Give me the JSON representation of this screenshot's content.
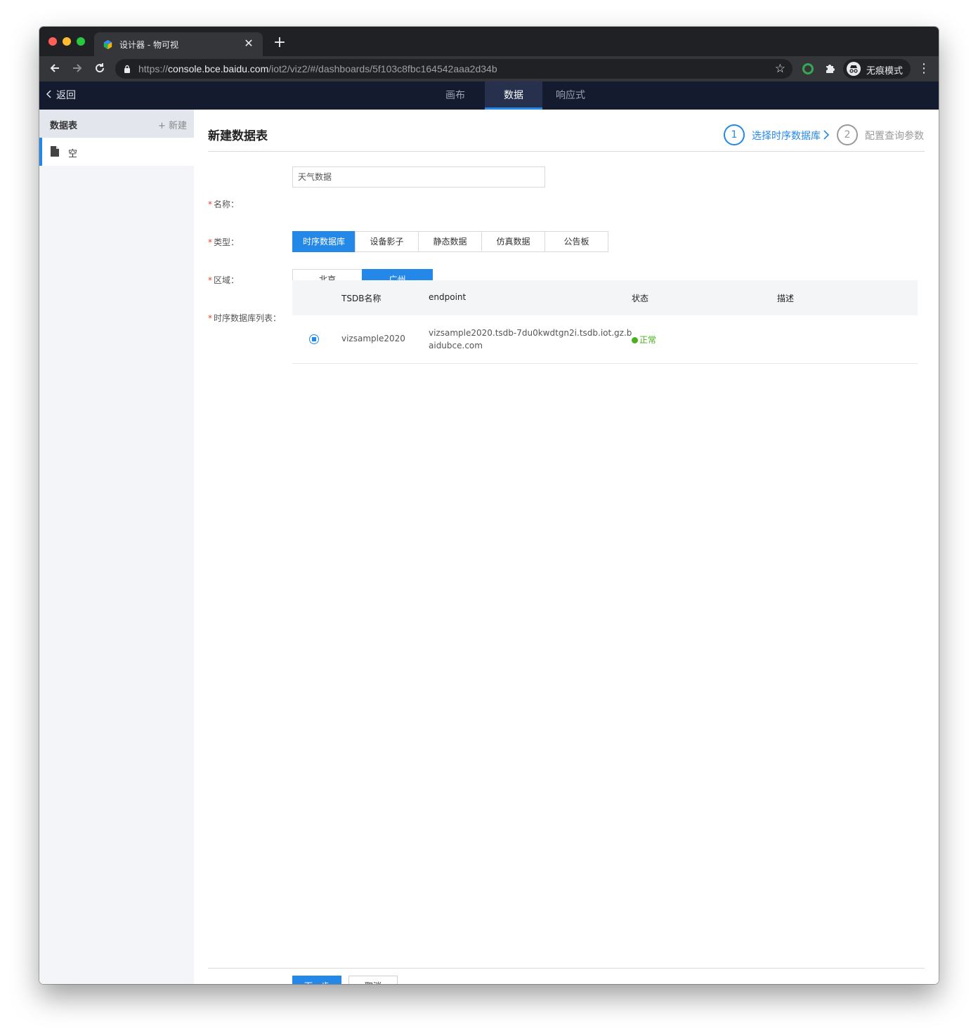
{
  "browser": {
    "tab_title": "设计器 - 物可视",
    "new_tab": "+",
    "close": "✕",
    "url_scheme": "https://",
    "url_host": "console.bce.baidu.com",
    "url_path": "/iot2/viz2/#/dashboards/5f103c8fbc164542aaa2d34b",
    "incognito_label": "无痕模式"
  },
  "appbar": {
    "back_label": "返回",
    "tabs": [
      {
        "label": "画布"
      },
      {
        "label": "数据"
      },
      {
        "label": "响应式"
      }
    ],
    "active_tab": "数据"
  },
  "sidebar": {
    "title": "数据表",
    "new_label": "+ 新建",
    "items": [
      {
        "label": "空"
      }
    ]
  },
  "main": {
    "title": "新建数据表",
    "steps": [
      {
        "number": "1",
        "label": "选择时序数据库",
        "active": true
      },
      {
        "number": "2",
        "label": "配置查询参数",
        "active": false
      }
    ],
    "form": {
      "name_label": "名称：",
      "name_value": "天气数据",
      "type_label": "类型：",
      "type_options": [
        "时序数据库",
        "设备影子",
        "静态数据",
        "仿真数据",
        "公告板"
      ],
      "type_selected": "时序数据库",
      "region_label": "区域：",
      "region_options": [
        "北京",
        "广州"
      ],
      "region_selected": "广州",
      "tsdb_label": "时序数据库列表："
    },
    "table": {
      "columns": [
        "TSDB名称",
        "endpoint",
        "状态",
        "描述"
      ],
      "rows": [
        {
          "name": "vizsample2020",
          "endpoint_line1": "vizsample2020.tsdb-7du0kwdtgn2i.tsdb.iot.gz.b",
          "endpoint_line2": "aidubce.com",
          "status": "正常",
          "description": "",
          "selected": true
        }
      ]
    },
    "buttons": {
      "next": "下一步",
      "cancel": "取消"
    }
  },
  "colors": {
    "accent": "#2488e8",
    "appbar_bg": "#151b2e",
    "status_ok": "#48b018",
    "required": "#e8412c"
  }
}
